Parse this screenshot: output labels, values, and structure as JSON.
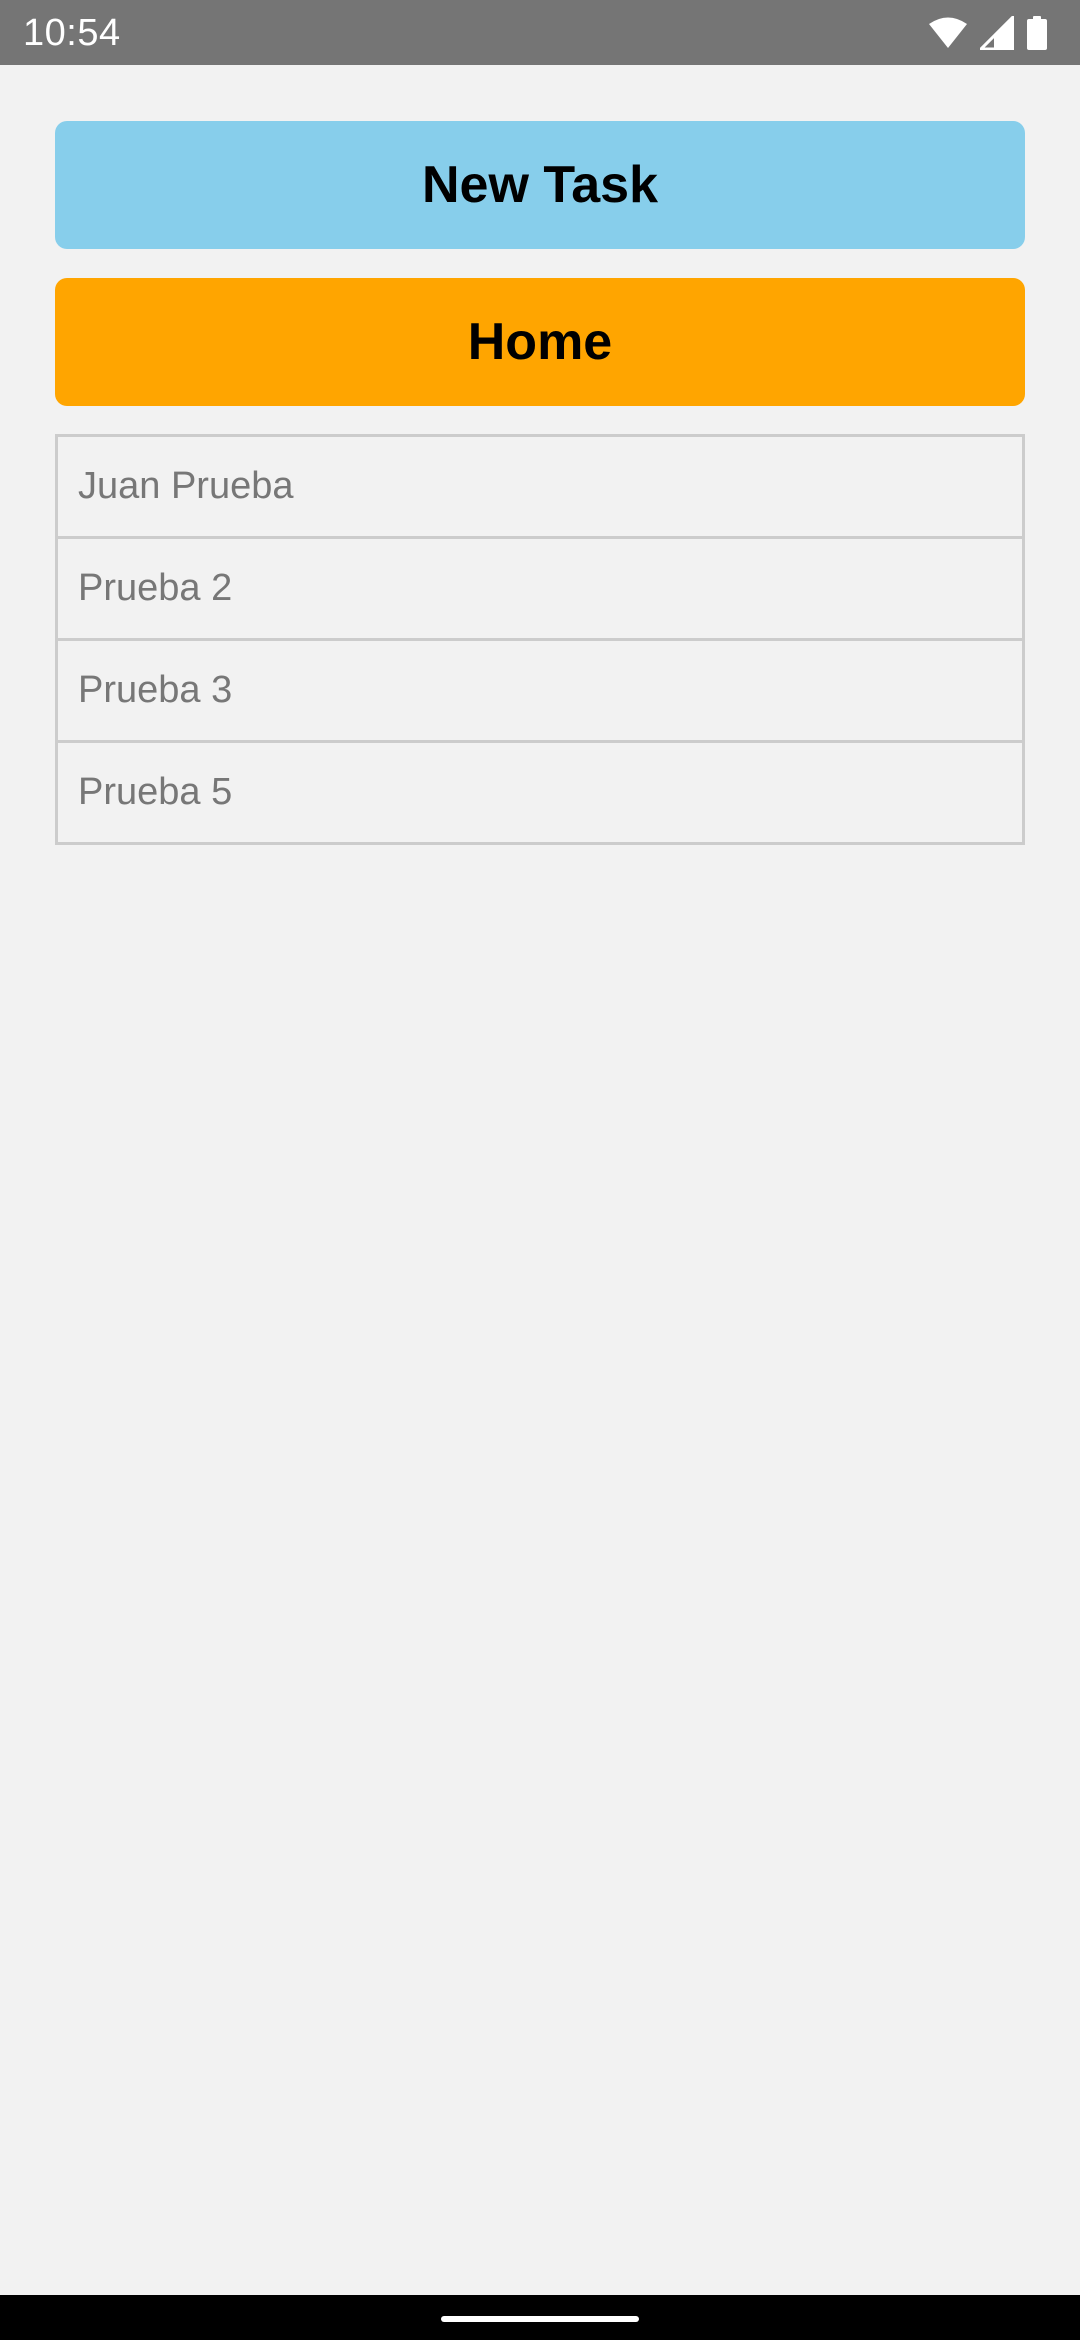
{
  "status_bar": {
    "time": "10:54",
    "icons": [
      "wifi-icon",
      "cellular-signal-icon",
      "battery-icon"
    ]
  },
  "buttons": {
    "new_task": {
      "label": "New Task",
      "color": "#87ceeb"
    },
    "home": {
      "label": "Home",
      "color": "#ffa500"
    }
  },
  "tasks": [
    {
      "title": "Juan Prueba"
    },
    {
      "title": "Prueba 2"
    },
    {
      "title": "Prueba 3"
    },
    {
      "title": "Prueba 5"
    }
  ],
  "colors": {
    "background": "#f2f2f2",
    "status_bar": "#757575",
    "list_border": "#cccccc",
    "list_text": "#777777"
  }
}
